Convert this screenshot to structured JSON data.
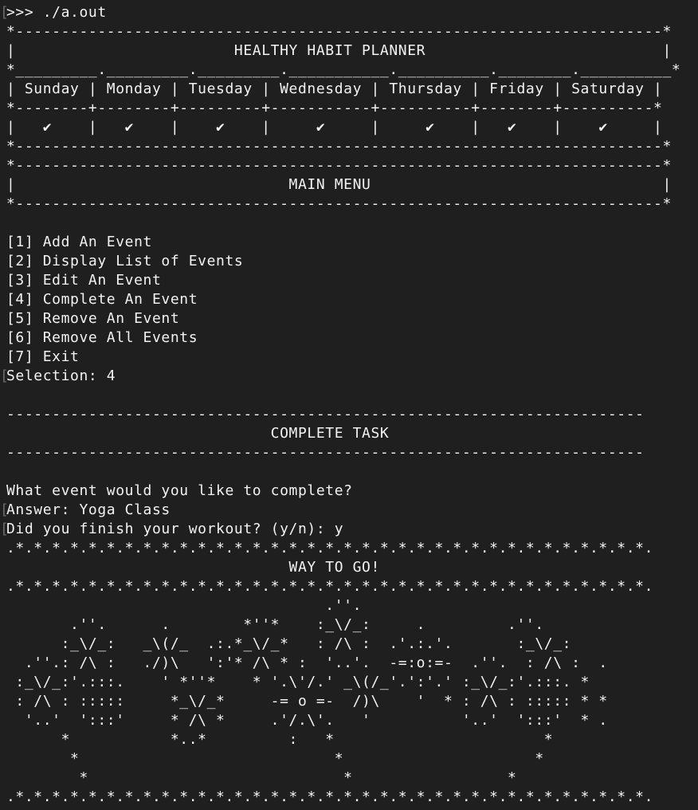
{
  "terminal": {
    "lines": [
      {
        "text": ">>> ./a.out",
        "marker": true
      },
      {
        "text": "*-----------------------------------------------------------------------*",
        "marker": false
      },
      {
        "text": "|                        HEALTHY HABIT PLANNER                          |",
        "marker": false
      },
      {
        "text": "*_________._________._________.___________.__________.________.__________*",
        "marker": false
      },
      {
        "text": "| Sunday | Monday | Tuesday | Wednesday | Thursday | Friday | Saturday |",
        "marker": false
      },
      {
        "text": "*--------+--------+---------+-----------+----------+--------+----------*",
        "marker": false
      },
      {
        "text": "|   ✔    |   ✔    |    ✔    |     ✔     |     ✔    |   ✔    |    ✔     |",
        "marker": false
      },
      {
        "text": "*-----------------------------------------------------------------------*",
        "marker": false
      },
      {
        "text": "*-----------------------------------------------------------------------*",
        "marker": false
      },
      {
        "text": "|                              MAIN MENU                                |",
        "marker": false
      },
      {
        "text": "*-----------------------------------------------------------------------*",
        "marker": false
      },
      {
        "text": "",
        "marker": false
      },
      {
        "text": "[1] Add An Event",
        "marker": false
      },
      {
        "text": "[2] Display List of Events",
        "marker": false
      },
      {
        "text": "[3] Edit An Event",
        "marker": false
      },
      {
        "text": "[4] Complete An Event",
        "marker": false
      },
      {
        "text": "[5] Remove An Event",
        "marker": false
      },
      {
        "text": "[6] Remove All Events",
        "marker": false
      },
      {
        "text": "[7] Exit",
        "marker": false
      },
      {
        "text": "Selection: 4",
        "marker": true
      },
      {
        "text": "",
        "marker": false
      },
      {
        "text": "----------------------------------------------------------------------",
        "marker": false
      },
      {
        "text": "                             COMPLETE TASK",
        "marker": false
      },
      {
        "text": "----------------------------------------------------------------------",
        "marker": false
      },
      {
        "text": "",
        "marker": false
      },
      {
        "text": "What event would you like to complete?",
        "marker": false
      },
      {
        "text": "Answer: Yoga Class",
        "marker": true
      },
      {
        "text": "Did you finish your workout? (y/n): y",
        "marker": true
      },
      {
        "text": ".*.*.*.*.*.*.*.*.*.*.*.*.*.*.*.*.*.*.*.*.*.*.*.*.*.*.*.*.*.*.*.*.*.*.*.",
        "marker": false
      },
      {
        "text": "                               WAY TO GO!",
        "marker": false
      },
      {
        "text": ".*.*.*.*.*.*.*.*.*.*.*.*.*.*.*.*.*.*.*.*.*.*.*.*.*.*.*.*.*.*.*.*.*.*.*.",
        "marker": false
      },
      {
        "text": "                                   .''.",
        "marker": false
      },
      {
        "text": "       .''.      .        *''*    :_\\/_:     .         .''.",
        "marker": false
      },
      {
        "text": "      :_\\/_:   _\\(/_  .:.*_\\/_*   : /\\ :  .'.:.'.       :_\\/_:",
        "marker": false
      },
      {
        "text": "  .''.: /\\ :   ./)\\   ':'* /\\ * :  '..'.  -=:o:=-  .''.  : /\\ :  .",
        "marker": false
      },
      {
        "text": " :_\\/_:'.:::.    ' *''*    * '.\\'/.' _\\(/_'.':'.' :_\\/_:'.:::. *",
        "marker": false
      },
      {
        "text": " : /\\ : :::::     *_\\/_*     -= o =-  /)\\    '  * : /\\ : ::::: * *",
        "marker": false
      },
      {
        "text": "  '..'  ':::'     * /\\ *     .'/.\\'.   '          '..'  ':::'  * .",
        "marker": false
      },
      {
        "text": "      *           *..*         :   *                       *",
        "marker": false
      },
      {
        "text": "       *                            *                     *",
        "marker": false
      },
      {
        "text": "        *                            *                 *",
        "marker": false
      },
      {
        "text": ".*.*.*.*.*.*.*.*.*.*.*.*.*.*.*.*.*.*.*.*.*.*.*.*.*.*.*.*.*.*.*.*.*.*.*.",
        "marker": false
      }
    ],
    "prompt_marker_glyph": "["
  }
}
